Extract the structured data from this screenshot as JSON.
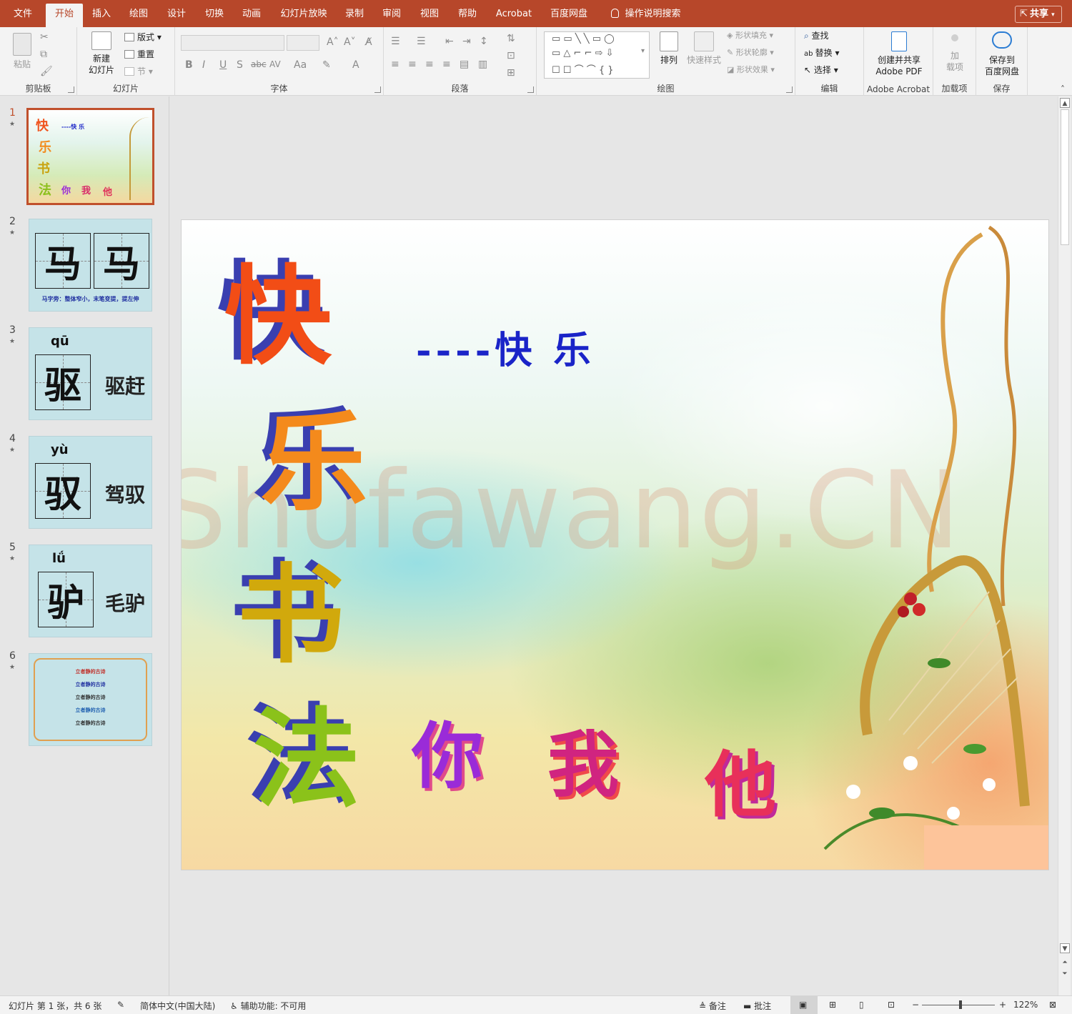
{
  "tabs": [
    {
      "label": "文件"
    },
    {
      "label": "开始",
      "active": true
    },
    {
      "label": "插入"
    },
    {
      "label": "绘图"
    },
    {
      "label": "设计"
    },
    {
      "label": "切换"
    },
    {
      "label": "动画"
    },
    {
      "label": "幻灯片放映"
    },
    {
      "label": "录制"
    },
    {
      "label": "审阅"
    },
    {
      "label": "视图"
    },
    {
      "label": "帮助"
    },
    {
      "label": "Acrobat"
    },
    {
      "label": "百度网盘"
    }
  ],
  "tell_me": "操作说明搜索",
  "share": "共享",
  "ribbon": {
    "clipboard": {
      "label": "剪贴板",
      "paste": "粘贴"
    },
    "slides": {
      "label": "幻灯片",
      "new_slide_1": "新建",
      "new_slide_2": "幻灯片",
      "layout": "版式",
      "reset": "重置",
      "section": "节"
    },
    "font": {
      "label": "字体"
    },
    "paragraph": {
      "label": "段落"
    },
    "drawing": {
      "label": "绘图",
      "arrange": "排列",
      "quick_styles": "快速样式",
      "shape_fill": "形状填充",
      "shape_outline": "形状轮廓",
      "shape_effects": "形状效果"
    },
    "editing": {
      "label": "编辑",
      "find": "查找",
      "replace": "替换",
      "select": "选择"
    },
    "acrobat": {
      "label": "Adobe Acrobat",
      "create_1": "创建并共享",
      "create_2": "Adobe PDF"
    },
    "addins": {
      "label": "加载项",
      "btn_1": "加",
      "btn_2": "载项"
    },
    "save": {
      "label": "保存",
      "btn_1": "保存到",
      "btn_2": "百度网盘"
    }
  },
  "thumbnails": [
    {
      "num": "1"
    },
    {
      "num": "2",
      "char": "马",
      "caption": "马字旁：整体窄小，末笔变提，提左伸"
    },
    {
      "num": "3",
      "pinyin": "qū",
      "char": "驱",
      "word": "驱赶"
    },
    {
      "num": "4",
      "pinyin": "yù",
      "char": "驭",
      "word": "驾驭"
    },
    {
      "num": "5",
      "pinyin": "lǘ",
      "char": "驴",
      "word": "毛驴"
    },
    {
      "num": "6",
      "lines": [
        "立者静的古诗",
        "立者静的古诗",
        "立者静的古诗",
        "立者静的古诗",
        "立者静的古诗"
      ]
    }
  ],
  "slide": {
    "big_chars": [
      "快",
      "乐",
      "书",
      "法"
    ],
    "subtitle": "----快 乐",
    "small_chars": [
      "你",
      "我",
      "他"
    ],
    "watermark": "Shufawang.CN"
  },
  "status": {
    "slide_info": "幻灯片 第 1 张，共 6 张",
    "language": "简体中文(中国大陆)",
    "accessibility": "辅助功能: 不可用",
    "notes": "备注",
    "comments": "批注",
    "zoom": "122%"
  },
  "colors": {
    "accent": "#b7472a",
    "active_thumb": "#c0502c",
    "thumb_bg": "#c5e3e8"
  }
}
